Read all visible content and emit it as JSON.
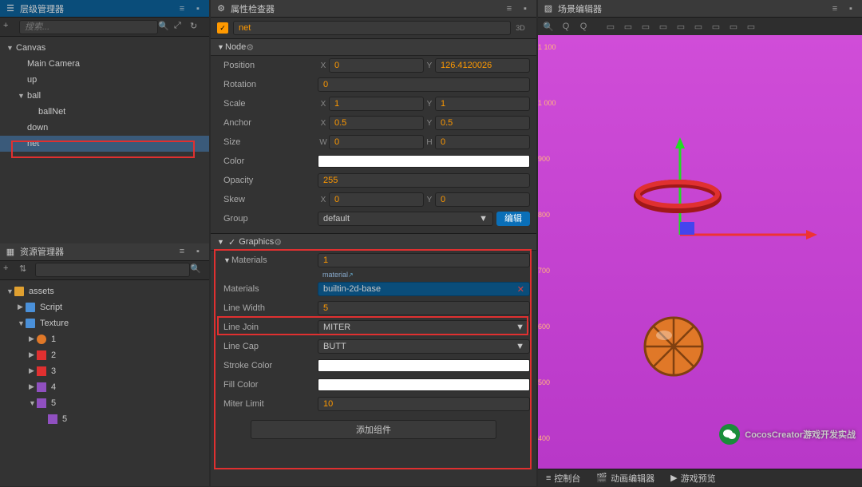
{
  "panels": {
    "hierarchy": "层级管理器",
    "assets": "资源管理器",
    "inspector": "属性检查器",
    "scene": "场景编辑器"
  },
  "search_ph": "搜索...",
  "hierarchy": [
    {
      "label": "Canvas",
      "depth": 0,
      "arrow": "▼"
    },
    {
      "label": "Main Camera",
      "depth": 1,
      "arrow": ""
    },
    {
      "label": "up",
      "depth": 1,
      "arrow": ""
    },
    {
      "label": "ball",
      "depth": 1,
      "arrow": "▼"
    },
    {
      "label": "ballNet",
      "depth": 2,
      "arrow": ""
    },
    {
      "label": "down",
      "depth": 1,
      "arrow": ""
    },
    {
      "label": "net",
      "depth": 1,
      "arrow": "",
      "sel": true
    }
  ],
  "assets": [
    {
      "label": "assets",
      "depth": 0,
      "arrow": "▼",
      "ico": "db"
    },
    {
      "label": "Script",
      "depth": 1,
      "arrow": "▶",
      "ico": "folder"
    },
    {
      "label": "Texture",
      "depth": 1,
      "arrow": "▼",
      "ico": "folder"
    },
    {
      "label": "1",
      "depth": 2,
      "arrow": "▶",
      "ico": "ball"
    },
    {
      "label": "2",
      "depth": 2,
      "arrow": "▶",
      "ico": "red"
    },
    {
      "label": "3",
      "depth": 2,
      "arrow": "▶",
      "ico": "red"
    },
    {
      "label": "4",
      "depth": 2,
      "arrow": "▶",
      "ico": "purp"
    },
    {
      "label": "5",
      "depth": 2,
      "arrow": "▼",
      "ico": "purp"
    },
    {
      "label": "5",
      "depth": 3,
      "arrow": "",
      "ico": "purp"
    }
  ],
  "inspector": {
    "name": "net",
    "mode": "3D",
    "node_section": "Node",
    "props": {
      "position": {
        "label": "Position",
        "x": "0",
        "y": "126.4120026"
      },
      "rotation": {
        "label": "Rotation",
        "v": "0"
      },
      "scale": {
        "label": "Scale",
        "x": "1",
        "y": "1"
      },
      "anchor": {
        "label": "Anchor",
        "x": "0.5",
        "y": "0.5"
      },
      "size": {
        "label": "Size",
        "w": "0",
        "h": "0"
      },
      "color": {
        "label": "Color"
      },
      "opacity": {
        "label": "Opacity",
        "v": "255"
      },
      "skew": {
        "label": "Skew",
        "x": "0",
        "y": "0"
      },
      "group": {
        "label": "Group",
        "v": "default",
        "btn": "编辑"
      }
    },
    "graphics": {
      "title": "Graphics",
      "materials_label": "Materials",
      "materials_count": "1",
      "material_tag": "material",
      "material_name": "builtin-2d-base",
      "line_width": {
        "label": "Line Width",
        "v": "5"
      },
      "line_join": {
        "label": "Line Join",
        "v": "MITER"
      },
      "line_cap": {
        "label": "Line Cap",
        "v": "BUTT"
      },
      "stroke": {
        "label": "Stroke Color"
      },
      "fill": {
        "label": "Fill Color"
      },
      "miter": {
        "label": "Miter Limit",
        "v": "10"
      }
    },
    "add_component": "添加组件"
  },
  "ruler": [
    "1 100",
    "1 000",
    "900",
    "800",
    "700",
    "600",
    "500",
    "400"
  ],
  "bottom": {
    "console": "控制台",
    "timeline": "动画编辑器",
    "preview": "游戏预览"
  },
  "watermark": "CocosCreator游戏开发实战"
}
